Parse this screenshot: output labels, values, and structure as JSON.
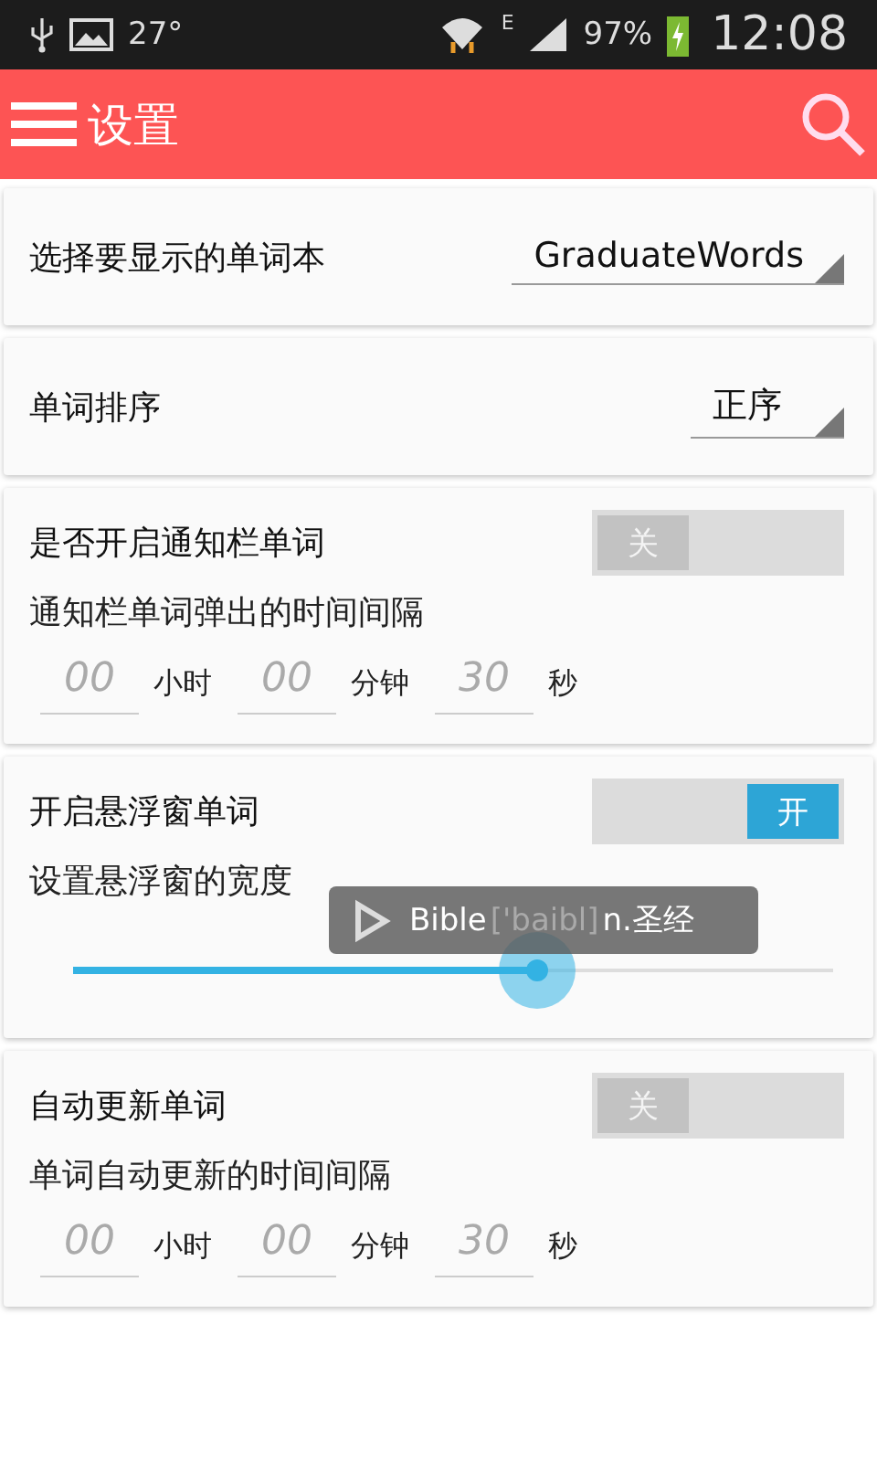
{
  "status_bar": {
    "temperature": "27°",
    "network": "E",
    "battery": "97%",
    "time": "12:08"
  },
  "app_bar": {
    "title": "设置"
  },
  "settings": [
    {
      "kind": "dropdown",
      "label": "选择要显示的单词本",
      "value": "GraduateWords"
    },
    {
      "kind": "dropdown",
      "label": "单词排序",
      "value": "正序"
    },
    {
      "kind": "timer",
      "label": "是否开启通知栏单词",
      "switch": {
        "on": false,
        "label": "关"
      },
      "sublabel": "通知栏单词弹出的时间间隔",
      "fields": [
        {
          "placeholder": "00",
          "unit": "小时"
        },
        {
          "placeholder": "00",
          "unit": "分钟"
        },
        {
          "placeholder": "30",
          "unit": "秒"
        }
      ]
    },
    {
      "kind": "slider",
      "label": "开启悬浮窗单词",
      "switch": {
        "on": true,
        "label": "开"
      },
      "sublabel": "设置悬浮窗的宽度",
      "level": 0.61
    },
    {
      "kind": "timer",
      "label": "自动更新单词",
      "switch": {
        "on": false,
        "label": "关"
      },
      "sublabel": "单词自动更新的时间间隔",
      "fields": [
        {
          "placeholder": "00",
          "unit": "小时"
        },
        {
          "placeholder": "00",
          "unit": "分钟"
        },
        {
          "placeholder": "30",
          "unit": "秒"
        }
      ]
    }
  ],
  "floating_word": {
    "word": "Bible",
    "phonetic": "['baibl]",
    "meaning": "n.圣经"
  }
}
